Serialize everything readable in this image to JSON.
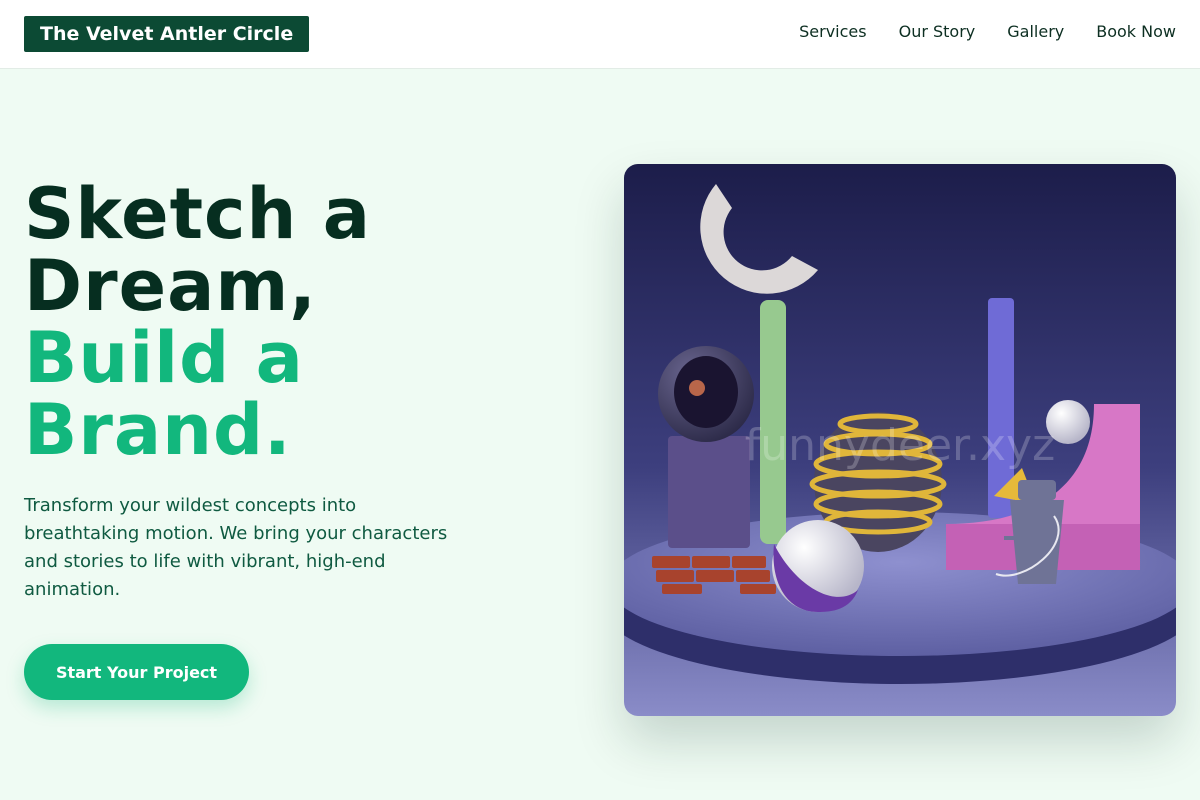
{
  "header": {
    "brand": "The Velvet Antler Circle",
    "nav": [
      {
        "label": "Services"
      },
      {
        "label": "Our Story"
      },
      {
        "label": "Gallery"
      },
      {
        "label": "Book Now"
      }
    ]
  },
  "hero": {
    "headline_dark_1": "Sketch a",
    "headline_dark_2": "Dream,",
    "headline_green_1": "Build a",
    "headline_green_2": "Brand.",
    "description": "Transform your wildest concepts into breathtaking motion. We bring your characters and stories to life with vibrant, high-end animation.",
    "cta_label": "Start Your Project",
    "image_watermark": "funnydeer.xyz"
  },
  "colors": {
    "background": "#effbf3",
    "brand_dark": "#0c4a34",
    "accent_green": "#12b77d",
    "headline_dark": "#062e20"
  }
}
